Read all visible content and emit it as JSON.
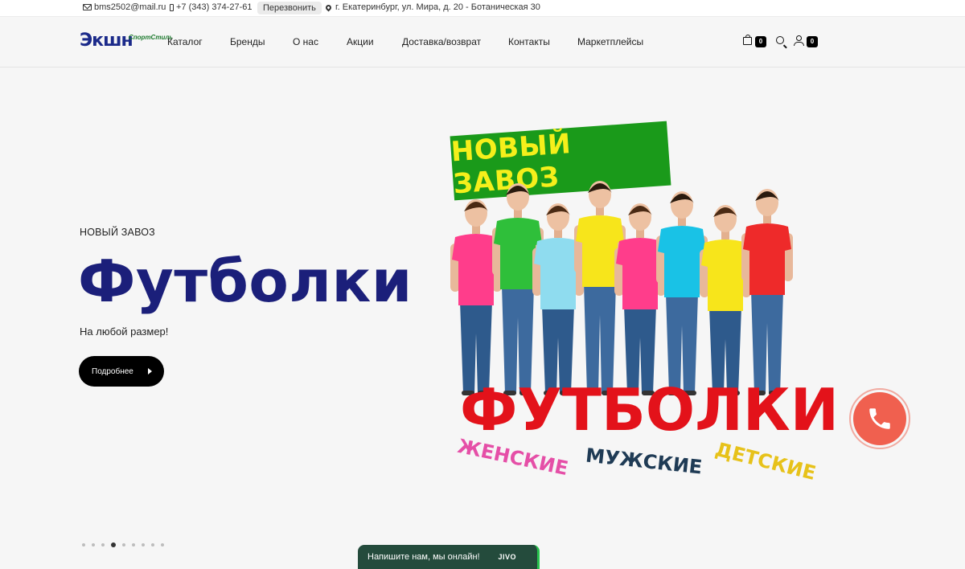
{
  "topbar": {
    "email": "bms2502@mail.ru",
    "phone": "+7 (343) 374-27-61",
    "callback_label": "Перезвонить",
    "address": "г. Екатеринбург, ул. Мира, д. 20 - Ботаническая 30"
  },
  "header": {
    "logo_main": "Экшн",
    "logo_sub": "СпортСтиль",
    "nav": [
      "Каталог",
      "Бренды",
      "О нас",
      "Акции",
      "Доставка/возврат",
      "Контакты",
      "Маркетплейсы"
    ],
    "cart_count": "0",
    "account_count": "0"
  },
  "hero": {
    "eyebrow": "НОВЫЙ ЗАВОЗ",
    "title": "Футболки",
    "subtitle": "На любой размер!",
    "button_label": "Подробнее"
  },
  "banner": {
    "top_label": "НОВЫЙ ЗАВОЗ",
    "big_word": "ФУТБОЛКИ",
    "categories": [
      "ЖЕНСКИЕ",
      "МУЖСКИЕ",
      "ДЕТСКИЕ"
    ],
    "shirt_colors": [
      "#ff3d8b",
      "#2fbf3a",
      "#8fdcef",
      "#f7e51b",
      "#ff3d8b",
      "#19c2e6",
      "#f7e51b",
      "#ee2a2a"
    ]
  },
  "slider": {
    "total": 9,
    "active": 4
  },
  "chat": {
    "label": "Напишите нам, мы онлайн!",
    "brand": "JIVO"
  },
  "colors": {
    "brand_blue": "#1b1f7a",
    "accent_red": "#e3121a",
    "call_button": "#f0604f",
    "chat_bg": "#244b3c"
  }
}
